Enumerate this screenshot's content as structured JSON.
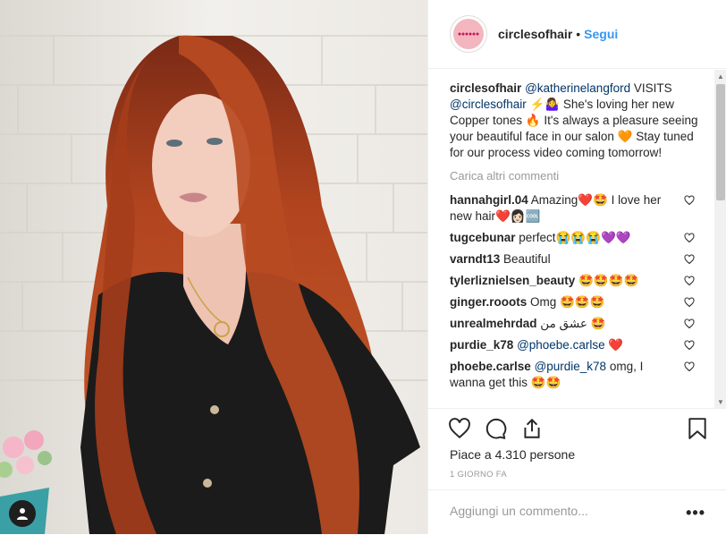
{
  "post": {
    "username": "circlesofhair",
    "separator": "•",
    "follow_label": "Segui",
    "avatar_icon": "circlesofhair-logo-icon",
    "caption": {
      "username": "circlesofhair",
      "mention1": "@katherinelangford",
      "text1": " VISITS ",
      "mention2": "@circlesofhair",
      "emoji1": "⚡🤷‍♀️",
      "text2": " She's loving her new Copper tones ",
      "emoji2": "🔥",
      "text3": " It's always a pleasure seeing your beautiful face in our salon ",
      "emoji3": "🧡",
      "text4": " Stay tuned for our process video coming tomorrow!"
    },
    "load_more": "Carica altri commenti",
    "comments": [
      {
        "user": "hannahgirl.04",
        "text": " Amazing❤️🤩 I love her new hair❤️👩🏻🆒"
      },
      {
        "user": "tugcebunar",
        "text": " perfect😭😭😭💜💜"
      },
      {
        "user": "varndt13",
        "text": " Beautiful"
      },
      {
        "user": "tylerliznielsen_beauty",
        "text": " 🤩🤩🤩🤩"
      },
      {
        "user": "ginger.rooots",
        "text": " Omg 🤩🤩🤩"
      },
      {
        "user": "unrealmehrdad",
        "text": " عشق من 🤩"
      },
      {
        "user": "purdie_k78",
        "mention": "@phoebe.carlse",
        "text": " ❤️"
      },
      {
        "user": "phoebe.carlse",
        "mention": "@purdie_k78",
        "text": " omg, I wanna get this 🤩🤩"
      }
    ],
    "likes_label": "Piace a 4.310 persone",
    "time_label": "1 GIORNO FA",
    "add_comment_placeholder": "Aggiungi un commento...",
    "more_label": "•••",
    "icons": {
      "like": "heart-icon",
      "comment": "comment-icon",
      "share": "share-icon",
      "save": "bookmark-icon",
      "user_tags": "user-tag-icon"
    },
    "colors": {
      "link": "#3897f0",
      "mention": "#003569",
      "text": "#262626",
      "muted": "#999999",
      "border": "#efefef"
    }
  }
}
